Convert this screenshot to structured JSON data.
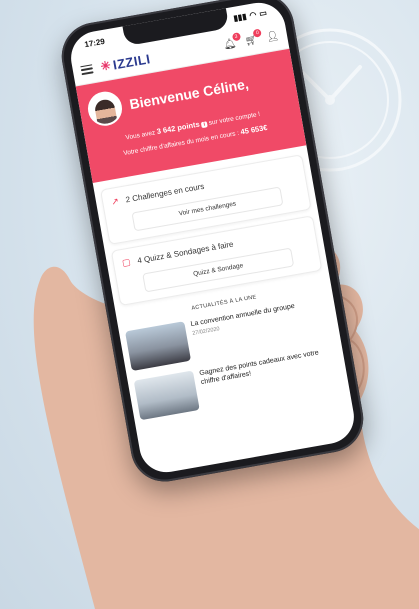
{
  "status": {
    "time": "17:29"
  },
  "header": {
    "logo_text": "IZZILI",
    "notif_badge": "3",
    "cart_badge": "0"
  },
  "hero": {
    "welcome": "Bienvenue Céline,",
    "points_prefix": "Vous avez",
    "points_value": "3 642 points",
    "points_suffix": "sur votre compte !",
    "ca_label": "Votre chiffre d'affaires du mois en cours :",
    "ca_value": "45 653€"
  },
  "challenges": {
    "label": "2 Challenges en cours",
    "button": "Voir mes challenges"
  },
  "quizz": {
    "label": "4 Quizz & Sondages à faire",
    "button": "Quizz & Sondage"
  },
  "news_section": {
    "title": "ACTUALITÉS À LA UNE",
    "items": [
      {
        "title": "La convention annuelle du groupe",
        "date": "27/02/2020"
      },
      {
        "title": "Gagnez des points cadeaux avec votre chiffre d'affaires!",
        "date": ""
      }
    ]
  },
  "colors": {
    "brand_pink": "#f04a67",
    "brand_blue": "#2b3a8f"
  }
}
